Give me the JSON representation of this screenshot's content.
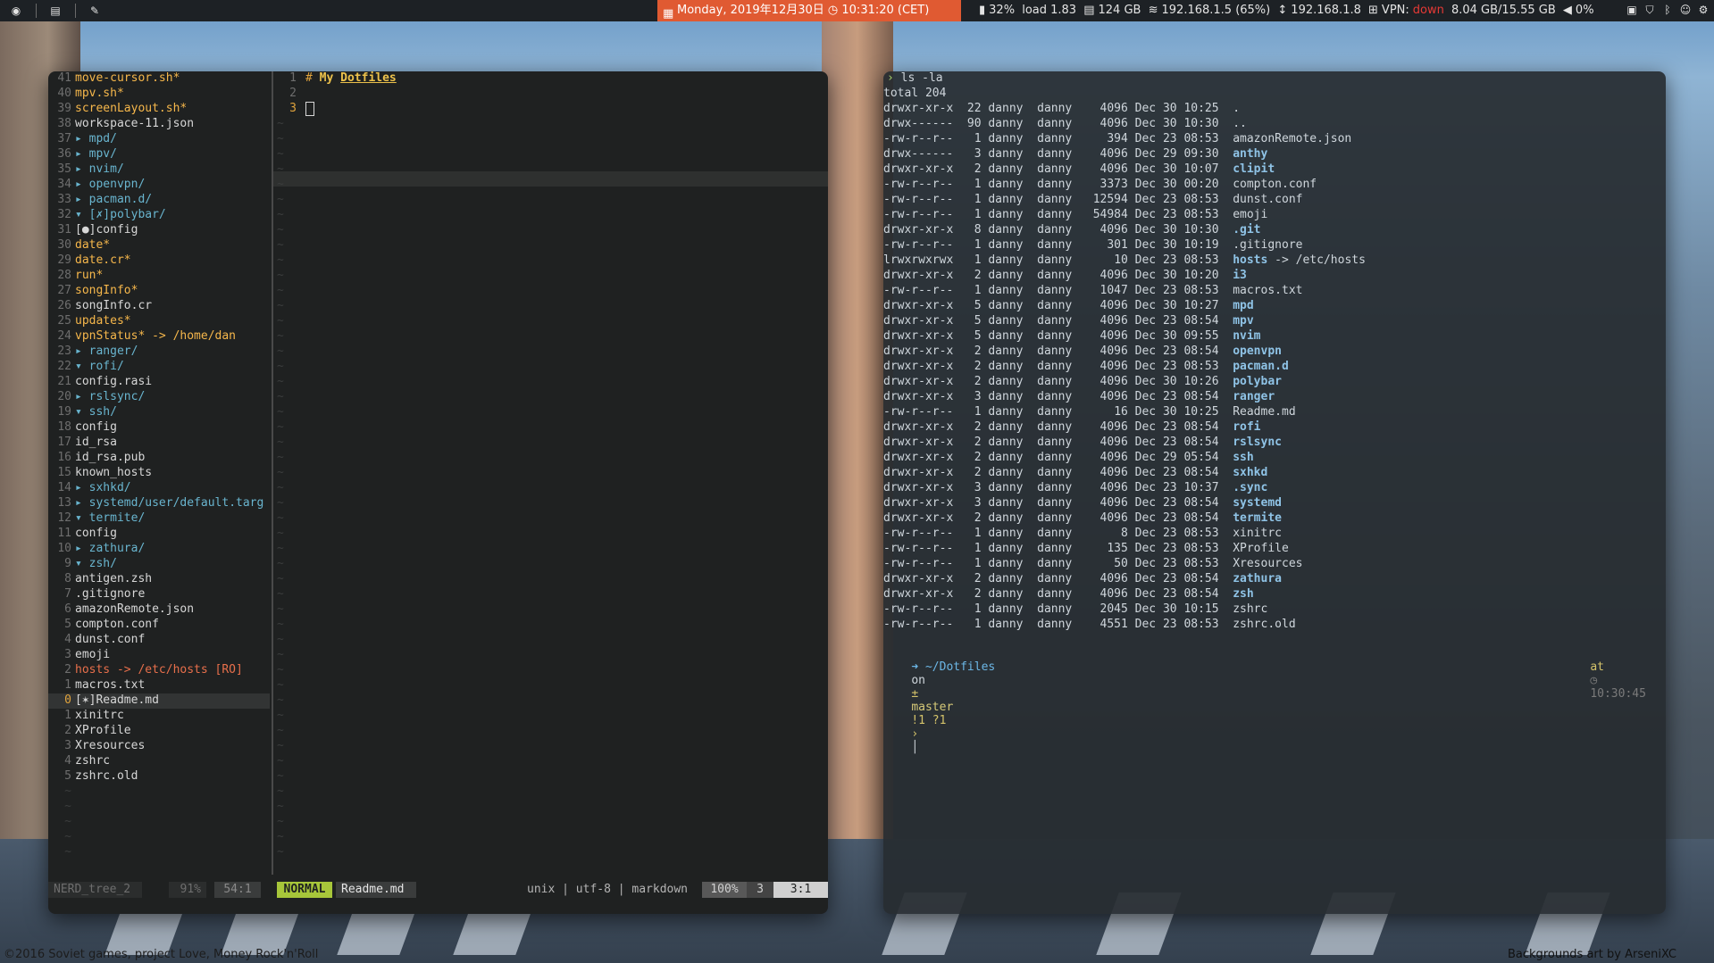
{
  "topbar": {
    "workspace_icons": [
      "firefox-icon",
      "document-icon",
      "wrench-icon"
    ],
    "date": "Monday, 2019年12月30日",
    "time": "10:31:20 (CET)",
    "battery": "32%",
    "load": "load 1.83",
    "disk": "124 GB",
    "wifi": "192.168.1.5 (65%)",
    "eth": "192.168.1.8",
    "vpn_label": "VPN:",
    "vpn_status": "down",
    "memory": "8.04 GB/15.55 GB",
    "volume": "0%",
    "colors": {
      "date_bg": "#e05a32",
      "bar_bg": "#1d2125",
      "vpn_down": "#e53935"
    }
  },
  "nerdtree": {
    "rows": [
      {
        "ln": "41",
        "indent": 2,
        "text": "move-cursor.sh*",
        "kind": "exe"
      },
      {
        "ln": "40",
        "indent": 2,
        "text": "mpv.sh*",
        "kind": "exe"
      },
      {
        "ln": "39",
        "indent": 2,
        "text": "screenLayout.sh*",
        "kind": "exe"
      },
      {
        "ln": "38",
        "indent": 2,
        "text": "workspace-11.json",
        "kind": "file"
      },
      {
        "ln": "37",
        "indent": 0,
        "arrow": "▸",
        "text": "mpd/",
        "kind": "dir"
      },
      {
        "ln": "36",
        "indent": 0,
        "arrow": "▸",
        "text": "mpv/",
        "kind": "dir"
      },
      {
        "ln": "35",
        "indent": 0,
        "arrow": "▸",
        "text": "nvim/",
        "kind": "dir"
      },
      {
        "ln": "34",
        "indent": 0,
        "arrow": "▸",
        "text": "openvpn/",
        "kind": "dir"
      },
      {
        "ln": "33",
        "indent": 0,
        "arrow": "▸",
        "text": "pacman.d/",
        "kind": "dir"
      },
      {
        "ln": "32",
        "indent": 0,
        "arrow": "▾",
        "text": "[✗]polybar/",
        "kind": "dir"
      },
      {
        "ln": "31",
        "indent": 2,
        "text": "[●]config",
        "kind": "file"
      },
      {
        "ln": "30",
        "indent": 2,
        "text": "date*",
        "kind": "exe"
      },
      {
        "ln": "29",
        "indent": 2,
        "text": "date.cr*",
        "kind": "exe"
      },
      {
        "ln": "28",
        "indent": 2,
        "text": "run*",
        "kind": "exe"
      },
      {
        "ln": "27",
        "indent": 2,
        "text": "songInfo*",
        "kind": "exe"
      },
      {
        "ln": "26",
        "indent": 2,
        "text": "songInfo.cr",
        "kind": "file"
      },
      {
        "ln": "25",
        "indent": 2,
        "text": "updates*",
        "kind": "exe"
      },
      {
        "ln": "24",
        "indent": 2,
        "text": "vpnStatus* -> /home/dan",
        "kind": "exe"
      },
      {
        "ln": "23",
        "indent": 0,
        "arrow": "▸",
        "text": "ranger/",
        "kind": "dir"
      },
      {
        "ln": "22",
        "indent": 0,
        "arrow": "▾",
        "text": "rofi/",
        "kind": "dir"
      },
      {
        "ln": "21",
        "indent": 2,
        "text": "config.rasi",
        "kind": "file"
      },
      {
        "ln": "20",
        "indent": 0,
        "arrow": "▸",
        "text": "rslsync/",
        "kind": "dir"
      },
      {
        "ln": "19",
        "indent": 0,
        "arrow": "▾",
        "text": "ssh/",
        "kind": "dir"
      },
      {
        "ln": "18",
        "indent": 2,
        "text": "config",
        "kind": "file"
      },
      {
        "ln": "17",
        "indent": 2,
        "text": "id_rsa",
        "kind": "file"
      },
      {
        "ln": "16",
        "indent": 2,
        "text": "id_rsa.pub",
        "kind": "file"
      },
      {
        "ln": "15",
        "indent": 2,
        "text": "known_hosts",
        "kind": "file"
      },
      {
        "ln": "14",
        "indent": 0,
        "arrow": "▸",
        "text": "sxhkd/",
        "kind": "dir"
      },
      {
        "ln": "13",
        "indent": 0,
        "arrow": "▸",
        "text": "systemd/user/default.targ",
        "kind": "dir"
      },
      {
        "ln": "12",
        "indent": 0,
        "arrow": "▾",
        "text": "termite/",
        "kind": "dir"
      },
      {
        "ln": "11",
        "indent": 2,
        "text": "config",
        "kind": "file"
      },
      {
        "ln": "10",
        "indent": 0,
        "arrow": "▸",
        "text": "zathura/",
        "kind": "dir"
      },
      {
        "ln": "9",
        "indent": 0,
        "arrow": "▾",
        "text": "zsh/",
        "kind": "dir"
      },
      {
        "ln": "8",
        "indent": 2,
        "text": "antigen.zsh",
        "kind": "file"
      },
      {
        "ln": "7",
        "indent": 0,
        "text": ".gitignore",
        "kind": "file"
      },
      {
        "ln": "6",
        "indent": 0,
        "text": "amazonRemote.json",
        "kind": "file"
      },
      {
        "ln": "5",
        "indent": 0,
        "text": "compton.conf",
        "kind": "file"
      },
      {
        "ln": "4",
        "indent": 0,
        "text": "dunst.conf",
        "kind": "file"
      },
      {
        "ln": "3",
        "indent": 0,
        "text": "emoji",
        "kind": "file"
      },
      {
        "ln": "2",
        "indent": 0,
        "text": "hosts -> /etc/hosts [RO]",
        "kind": "link"
      },
      {
        "ln": "1",
        "indent": 0,
        "text": "macros.txt",
        "kind": "file"
      },
      {
        "ln": "0",
        "indent": 0,
        "text": "[✶]Readme.md",
        "kind": "file",
        "current": true
      },
      {
        "ln": "1",
        "indent": 0,
        "text": "xinitrc",
        "kind": "file"
      },
      {
        "ln": "2",
        "indent": 0,
        "text": "XProfile",
        "kind": "file"
      },
      {
        "ln": "3",
        "indent": 0,
        "text": "Xresources",
        "kind": "file"
      },
      {
        "ln": "4",
        "indent": 0,
        "text": "zshrc",
        "kind": "file"
      },
      {
        "ln": "5",
        "indent": 0,
        "text": "zshrc.old",
        "kind": "file"
      }
    ]
  },
  "editor": {
    "lines": [
      {
        "ln": "1",
        "hash": "#",
        "text": "My",
        "link": "Dotfiles"
      },
      {
        "ln": "2"
      },
      {
        "ln": "3",
        "cursor": true
      }
    ]
  },
  "statusline": {
    "tree_name": "NERD_tree_2",
    "tree_percent": "91%",
    "tree_pos": "54:1",
    "mode": "NORMAL",
    "filename": "Readme.md",
    "fileinfo": "unix | utf-8 | markdown",
    "percent": "100%",
    "lines": "3",
    "pos": "3:1",
    "colors": {
      "mode_bg": "#a7c63a",
      "percent_bg": "#585858",
      "pos_bg": "#d0d0d0"
    }
  },
  "terminal": {
    "command": "ls -la",
    "total": "total 204",
    "rows": [
      {
        "perm": "drwxr-xr-x",
        "n": "22",
        "u": "danny",
        "g": "danny",
        "size": "4096",
        "date": "Dec 30 10:25",
        "name": ".",
        "dir": false
      },
      {
        "perm": "drwx------",
        "n": "90",
        "u": "danny",
        "g": "danny",
        "size": "4096",
        "date": "Dec 30 10:30",
        "name": "..",
        "dir": false
      },
      {
        "perm": "-rw-r--r--",
        "n": "1",
        "u": "danny",
        "g": "danny",
        "size": "394",
        "date": "Dec 23 08:53",
        "name": "amazonRemote.json",
        "dir": false
      },
      {
        "perm": "drwx------",
        "n": "3",
        "u": "danny",
        "g": "danny",
        "size": "4096",
        "date": "Dec 29 09:30",
        "name": "anthy",
        "dir": true
      },
      {
        "perm": "drwxr-xr-x",
        "n": "2",
        "u": "danny",
        "g": "danny",
        "size": "4096",
        "date": "Dec 30 10:07",
        "name": "clipit",
        "dir": true
      },
      {
        "perm": "-rw-r--r--",
        "n": "1",
        "u": "danny",
        "g": "danny",
        "size": "3373",
        "date": "Dec 30 00:20",
        "name": "compton.conf",
        "dir": false
      },
      {
        "perm": "-rw-r--r--",
        "n": "1",
        "u": "danny",
        "g": "danny",
        "size": "12594",
        "date": "Dec 23 08:53",
        "name": "dunst.conf",
        "dir": false
      },
      {
        "perm": "-rw-r--r--",
        "n": "1",
        "u": "danny",
        "g": "danny",
        "size": "54984",
        "date": "Dec 23 08:53",
        "name": "emoji",
        "dir": false
      },
      {
        "perm": "drwxr-xr-x",
        "n": "8",
        "u": "danny",
        "g": "danny",
        "size": "4096",
        "date": "Dec 30 10:30",
        "name": ".git",
        "dir": true
      },
      {
        "perm": "-rw-r--r--",
        "n": "1",
        "u": "danny",
        "g": "danny",
        "size": "301",
        "date": "Dec 30 10:19",
        "name": ".gitignore",
        "dir": false
      },
      {
        "perm": "lrwxrwxrwx",
        "n": "1",
        "u": "danny",
        "g": "danny",
        "size": "10",
        "date": "Dec 23 08:53",
        "name": "hosts",
        "link": "-> /etc/hosts",
        "dir": true
      },
      {
        "perm": "drwxr-xr-x",
        "n": "2",
        "u": "danny",
        "g": "danny",
        "size": "4096",
        "date": "Dec 30 10:20",
        "name": "i3",
        "dir": true
      },
      {
        "perm": "-rw-r--r--",
        "n": "1",
        "u": "danny",
        "g": "danny",
        "size": "1047",
        "date": "Dec 23 08:53",
        "name": "macros.txt",
        "dir": false
      },
      {
        "perm": "drwxr-xr-x",
        "n": "5",
        "u": "danny",
        "g": "danny",
        "size": "4096",
        "date": "Dec 30 10:27",
        "name": "mpd",
        "dir": true
      },
      {
        "perm": "drwxr-xr-x",
        "n": "5",
        "u": "danny",
        "g": "danny",
        "size": "4096",
        "date": "Dec 23 08:54",
        "name": "mpv",
        "dir": true
      },
      {
        "perm": "drwxr-xr-x",
        "n": "5",
        "u": "danny",
        "g": "danny",
        "size": "4096",
        "date": "Dec 30 09:55",
        "name": "nvim",
        "dir": true
      },
      {
        "perm": "drwxr-xr-x",
        "n": "2",
        "u": "danny",
        "g": "danny",
        "size": "4096",
        "date": "Dec 23 08:54",
        "name": "openvpn",
        "dir": true
      },
      {
        "perm": "drwxr-xr-x",
        "n": "2",
        "u": "danny",
        "g": "danny",
        "size": "4096",
        "date": "Dec 23 08:53",
        "name": "pacman.d",
        "dir": true
      },
      {
        "perm": "drwxr-xr-x",
        "n": "2",
        "u": "danny",
        "g": "danny",
        "size": "4096",
        "date": "Dec 30 10:26",
        "name": "polybar",
        "dir": true
      },
      {
        "perm": "drwxr-xr-x",
        "n": "3",
        "u": "danny",
        "g": "danny",
        "size": "4096",
        "date": "Dec 23 08:54",
        "name": "ranger",
        "dir": true
      },
      {
        "perm": "-rw-r--r--",
        "n": "1",
        "u": "danny",
        "g": "danny",
        "size": "16",
        "date": "Dec 30 10:25",
        "name": "Readme.md",
        "dir": false
      },
      {
        "perm": "drwxr-xr-x",
        "n": "2",
        "u": "danny",
        "g": "danny",
        "size": "4096",
        "date": "Dec 23 08:54",
        "name": "rofi",
        "dir": true
      },
      {
        "perm": "drwxr-xr-x",
        "n": "2",
        "u": "danny",
        "g": "danny",
        "size": "4096",
        "date": "Dec 23 08:54",
        "name": "rslsync",
        "dir": true
      },
      {
        "perm": "drwxr-xr-x",
        "n": "2",
        "u": "danny",
        "g": "danny",
        "size": "4096",
        "date": "Dec 29 05:54",
        "name": "ssh",
        "dir": true
      },
      {
        "perm": "drwxr-xr-x",
        "n": "2",
        "u": "danny",
        "g": "danny",
        "size": "4096",
        "date": "Dec 23 08:54",
        "name": "sxhkd",
        "dir": true
      },
      {
        "perm": "drwxr-xr-x",
        "n": "3",
        "u": "danny",
        "g": "danny",
        "size": "4096",
        "date": "Dec 23 10:37",
        "name": ".sync",
        "dir": true
      },
      {
        "perm": "drwxr-xr-x",
        "n": "3",
        "u": "danny",
        "g": "danny",
        "size": "4096",
        "date": "Dec 23 08:54",
        "name": "systemd",
        "dir": true
      },
      {
        "perm": "drwxr-xr-x",
        "n": "2",
        "u": "danny",
        "g": "danny",
        "size": "4096",
        "date": "Dec 23 08:54",
        "name": "termite",
        "dir": true
      },
      {
        "perm": "-rw-r--r--",
        "n": "1",
        "u": "danny",
        "g": "danny",
        "size": "8",
        "date": "Dec 23 08:53",
        "name": "xinitrc",
        "dir": false
      },
      {
        "perm": "-rw-r--r--",
        "n": "1",
        "u": "danny",
        "g": "danny",
        "size": "135",
        "date": "Dec 23 08:53",
        "name": "XProfile",
        "dir": false
      },
      {
        "perm": "-rw-r--r--",
        "n": "1",
        "u": "danny",
        "g": "danny",
        "size": "50",
        "date": "Dec 23 08:53",
        "name": "Xresources",
        "dir": false
      },
      {
        "perm": "drwxr-xr-x",
        "n": "2",
        "u": "danny",
        "g": "danny",
        "size": "4096",
        "date": "Dec 23 08:54",
        "name": "zathura",
        "dir": true
      },
      {
        "perm": "drwxr-xr-x",
        "n": "2",
        "u": "danny",
        "g": "danny",
        "size": "4096",
        "date": "Dec 23 08:54",
        "name": "zsh",
        "dir": true
      },
      {
        "perm": "-rw-r--r--",
        "n": "1",
        "u": "danny",
        "g": "danny",
        "size": "2045",
        "date": "Dec 30 10:15",
        "name": "zshrc",
        "dir": false
      },
      {
        "perm": "-rw-r--r--",
        "n": "1",
        "u": "danny",
        "g": "danny",
        "size": "4551",
        "date": "Dec 23 08:53",
        "name": "zshrc.old",
        "dir": false
      }
    ],
    "prompt": {
      "path": "~/Dotfiles",
      "on": "on",
      "branch": "master",
      "git_status": "!1 ?1",
      "at": "at",
      "time": "10:30:45"
    }
  },
  "wallpaper": {
    "credit_left": "©2016 Soviet games, project Love, Money Rock'n'Roll",
    "credit_right": "Backgrounds art by ArseniXC"
  }
}
